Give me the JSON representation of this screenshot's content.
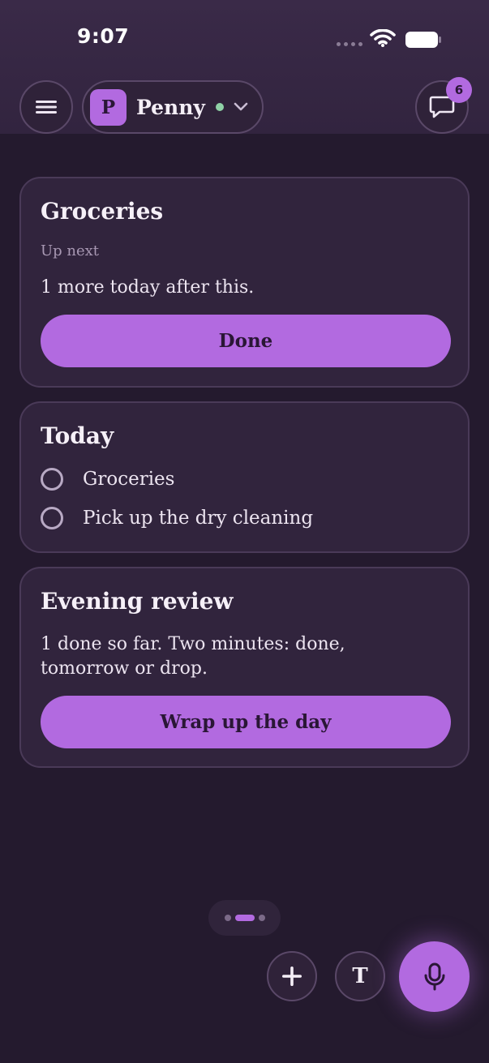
{
  "status_bar": {
    "time": "9:07"
  },
  "header": {
    "workspace": {
      "initial": "P",
      "name": "Penny"
    },
    "chat_badge_count": "6"
  },
  "cards": {
    "up_next": {
      "title": "Groceries",
      "subtitle": "Up next",
      "text": "1 more today after this.",
      "button_label": "Done"
    },
    "today": {
      "title": "Today",
      "tasks": [
        {
          "label": "Groceries"
        },
        {
          "label": "Pick up the dry cleaning"
        }
      ]
    },
    "evening_review": {
      "title": "Evening review",
      "text": "1 done so far. Two minutes: done, tomorrow or drop.",
      "button_label": "Wrap up the day"
    }
  },
  "bottom": {
    "text_button_glyph": "T",
    "pager_active_index": 1
  },
  "colors": {
    "accent": "#b26ae0",
    "background": "#241a2e",
    "card": "#31243d",
    "online": "#8fd1a6"
  },
  "icons": [
    "menu-icon",
    "chevron-down-icon",
    "chat-bubble-icon",
    "plus-icon",
    "microphone-icon",
    "wifi-icon",
    "battery-icon"
  ]
}
